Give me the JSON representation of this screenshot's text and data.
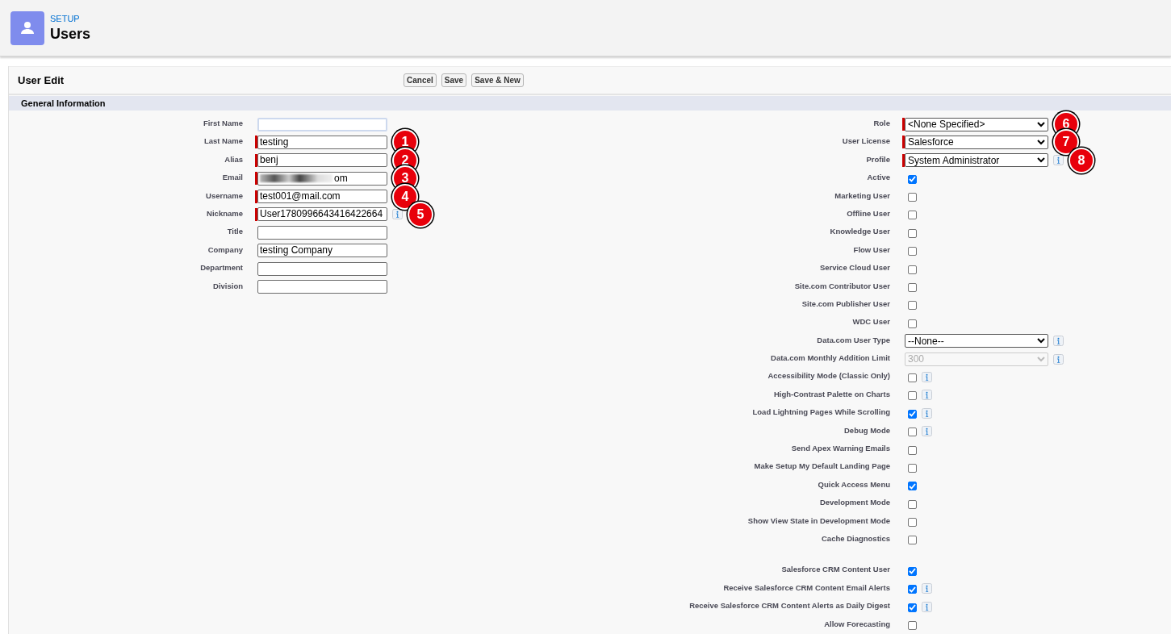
{
  "header": {
    "breadcrumb": "SETUP",
    "title": "Users"
  },
  "edit": {
    "title": "User Edit",
    "buttons": [
      "Cancel",
      "Save",
      "Save & New"
    ]
  },
  "section": {
    "title": "General Information"
  },
  "left_fields": [
    {
      "label": "First Name",
      "required": false,
      "focused": true
    },
    {
      "label": "Last Name",
      "value": "testing",
      "required": true,
      "focused": false,
      "badge": "1"
    },
    {
      "label": "Alias",
      "value": "benj",
      "required": true,
      "focused": false,
      "badge": "2"
    },
    {
      "label": "Email",
      "value": "om",
      "required": true,
      "focused": false,
      "redacted": true,
      "badge": "3"
    },
    {
      "label": "Username",
      "value": "test001@mail.com",
      "required": true,
      "focused": false,
      "badge": "4"
    },
    {
      "label": "Nickname",
      "value": "User1780996643416422664",
      "required": true,
      "focused": false,
      "info": true,
      "badge": "5"
    },
    {
      "label": "Title",
      "required": false,
      "focused": false
    },
    {
      "label": "Company",
      "value": "testing Company",
      "required": false,
      "focused": false
    },
    {
      "label": "Department",
      "required": false,
      "focused": false
    },
    {
      "label": "Division",
      "required": false,
      "focused": false
    }
  ],
  "right_groups": [
    [
      {
        "kind": "select",
        "label": "Role",
        "value": "<None Specified>",
        "required": true,
        "disabled": false,
        "badge": "6"
      },
      {
        "kind": "select",
        "label": "User License",
        "value": "Salesforce",
        "required": true,
        "disabled": false,
        "badge": "7"
      },
      {
        "kind": "select",
        "label": "Profile",
        "value": "System Administrator",
        "required": true,
        "disabled": false,
        "info": true,
        "badge": "8"
      },
      {
        "kind": "checkbox",
        "label": "Active",
        "checked": true
      },
      {
        "kind": "checkbox",
        "label": "Marketing User",
        "checked": false
      },
      {
        "kind": "checkbox",
        "label": "Offline User",
        "checked": false
      },
      {
        "kind": "checkbox",
        "label": "Knowledge User",
        "checked": false
      },
      {
        "kind": "checkbox",
        "label": "Flow User",
        "checked": false
      },
      {
        "kind": "checkbox",
        "label": "Service Cloud User",
        "checked": false
      },
      {
        "kind": "checkbox",
        "label": "Site.com Contributor User",
        "checked": false
      },
      {
        "kind": "checkbox",
        "label": "Site.com Publisher User",
        "checked": false
      },
      {
        "kind": "checkbox",
        "label": "WDC User",
        "checked": false
      },
      {
        "kind": "select",
        "label": "Data.com User Type",
        "value": "--None--",
        "required": false,
        "disabled": false,
        "info": true
      },
      {
        "kind": "select",
        "label": "Data.com Monthly Addition Limit",
        "value": "300",
        "required": false,
        "disabled": true,
        "info": true
      },
      {
        "kind": "checkbox",
        "label": "Accessibility Mode (Classic Only)",
        "checked": false,
        "info": true
      },
      {
        "kind": "checkbox",
        "label": "High-Contrast Palette on Charts",
        "checked": false,
        "info": true
      },
      {
        "kind": "checkbox",
        "label": "Load Lightning Pages While Scrolling",
        "checked": true,
        "info": true
      },
      {
        "kind": "checkbox",
        "label": "Debug Mode",
        "checked": false,
        "info": true
      },
      {
        "kind": "checkbox",
        "label": "Send Apex Warning Emails",
        "checked": false
      },
      {
        "kind": "checkbox",
        "label": "Make Setup My Default Landing Page",
        "checked": false
      },
      {
        "kind": "checkbox",
        "label": "Quick Access Menu",
        "checked": true
      },
      {
        "kind": "checkbox",
        "label": "Development Mode",
        "checked": false
      },
      {
        "kind": "checkbox",
        "label": "Show View State in Development Mode",
        "checked": false
      },
      {
        "kind": "checkbox",
        "label": "Cache Diagnostics",
        "checked": false
      }
    ],
    [
      {
        "kind": "checkbox",
        "label": "Salesforce CRM Content User",
        "checked": true
      },
      {
        "kind": "checkbox",
        "label": "Receive Salesforce CRM Content Email Alerts",
        "checked": true,
        "info": true
      },
      {
        "kind": "checkbox",
        "label": "Receive Salesforce CRM Content Alerts as Daily Digest",
        "checked": true,
        "info": true
      },
      {
        "kind": "checkbox",
        "label": "Allow Forecasting",
        "checked": false
      }
    ]
  ]
}
